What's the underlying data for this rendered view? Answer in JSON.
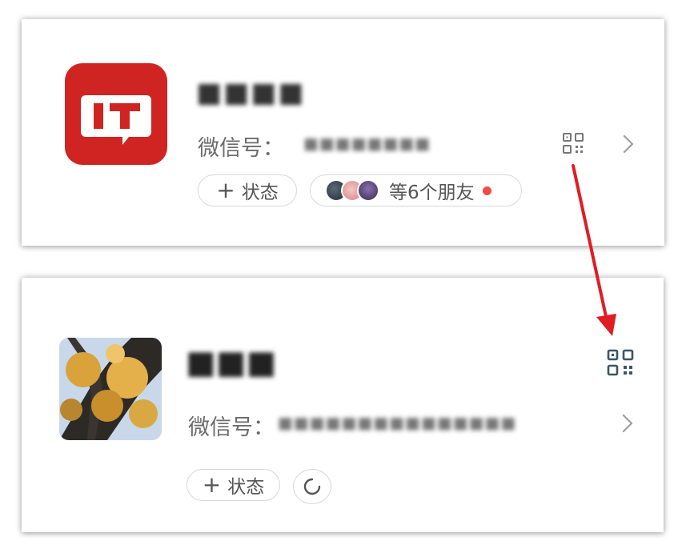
{
  "card1": {
    "app_logo_text": "IT",
    "name_masked": "■■■■",
    "wechat_id_label": "微信号：",
    "wechat_id_masked": "■■■■■■■■",
    "status_label": "状态",
    "friends_label": "等6个朋友"
  },
  "card2": {
    "name_masked": "■■■",
    "wechat_id_label": "微信号：",
    "wechat_id_masked": "■■■■■■■■■■■■■■■",
    "status_label": "状态"
  },
  "colors": {
    "brand_red": "#d02422",
    "arrow_red": "#e01c24",
    "qr_blue": "#3b5566",
    "badge_red": "#f04a4a"
  },
  "icons": [
    "it-logo",
    "qr-code-icon",
    "chevron-right-icon",
    "plus-icon",
    "refresh-circle-icon",
    "red-dot-icon",
    "arrow-annotation"
  ]
}
